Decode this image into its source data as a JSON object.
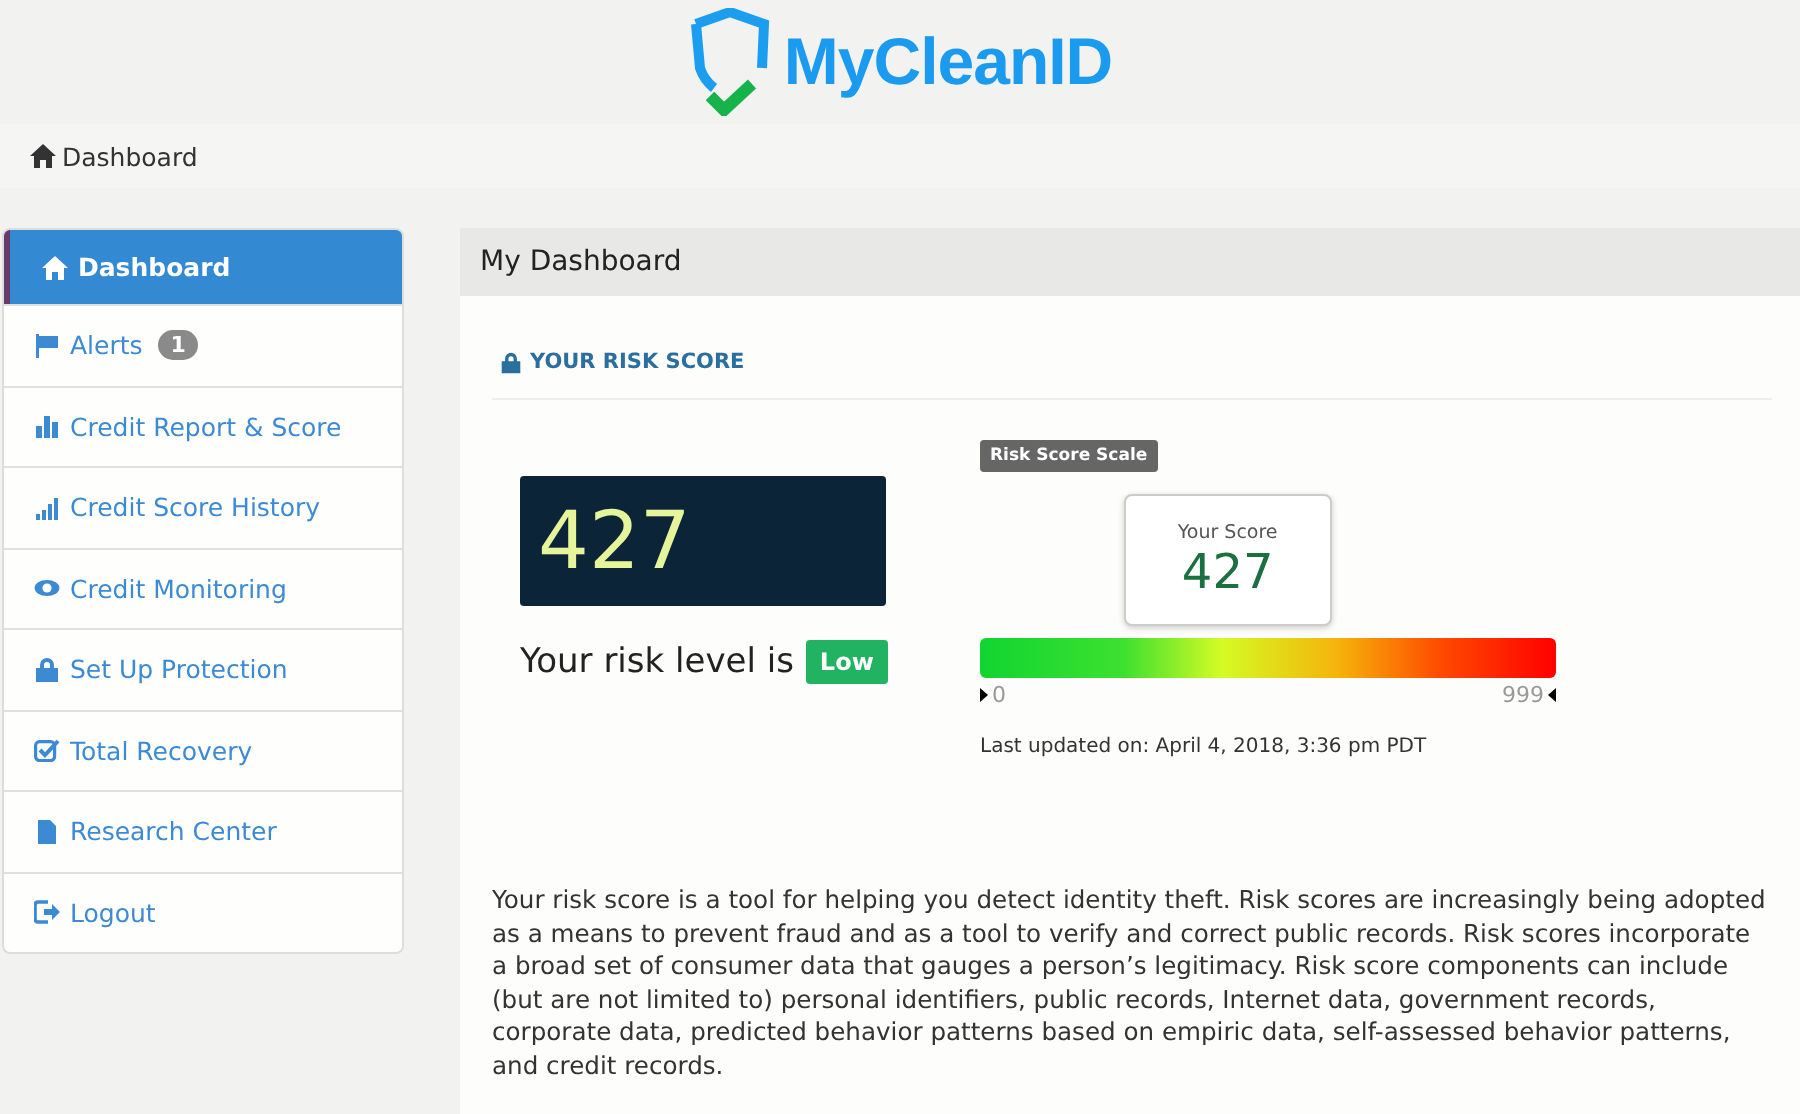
{
  "logo": {
    "text": "MyCleanID"
  },
  "breadcrumb": {
    "label": "Dashboard"
  },
  "sidebar": {
    "items": [
      {
        "label": "Dashboard",
        "selected": true
      },
      {
        "label": "Alerts",
        "selected": false,
        "badge": "1"
      },
      {
        "label": "Credit Report & Score",
        "selected": false
      },
      {
        "label": "Credit Score History",
        "selected": false
      },
      {
        "label": "Credit Monitoring",
        "selected": false
      },
      {
        "label": "Set Up Protection",
        "selected": false
      },
      {
        "label": "Total Recovery",
        "selected": false
      },
      {
        "label": "Research Center",
        "selected": false
      },
      {
        "label": "Logout",
        "selected": false
      }
    ]
  },
  "main": {
    "title": "My Dashboard",
    "section_title": "YOUR RISK SCORE",
    "score": "427",
    "risk_level_label": "Your risk level is",
    "risk_level": "Low",
    "scale": {
      "label": "Risk Score Scale",
      "tooltip_label": "Your Score",
      "tooltip_value": "427",
      "level": 0.43,
      "min": "0",
      "max": "999"
    },
    "last_updated": "Last updated on: April 4, 2018, 3:36 pm PDT",
    "description": "Your risk score is a tool for helping you detect identity theft. Risk scores are increasingly being adopted as a means to prevent fraud and as a tool to verify and correct public records. Risk scores incorporate a broad set of consumer data that gauges a person’s legitimacy. Risk score components can include (but are not limited to) personal identifiers, public records, Internet data, government records, corporate data, predicted behavior patterns based on empiric data, self-assessed behavior patterns, and credit records."
  }
}
